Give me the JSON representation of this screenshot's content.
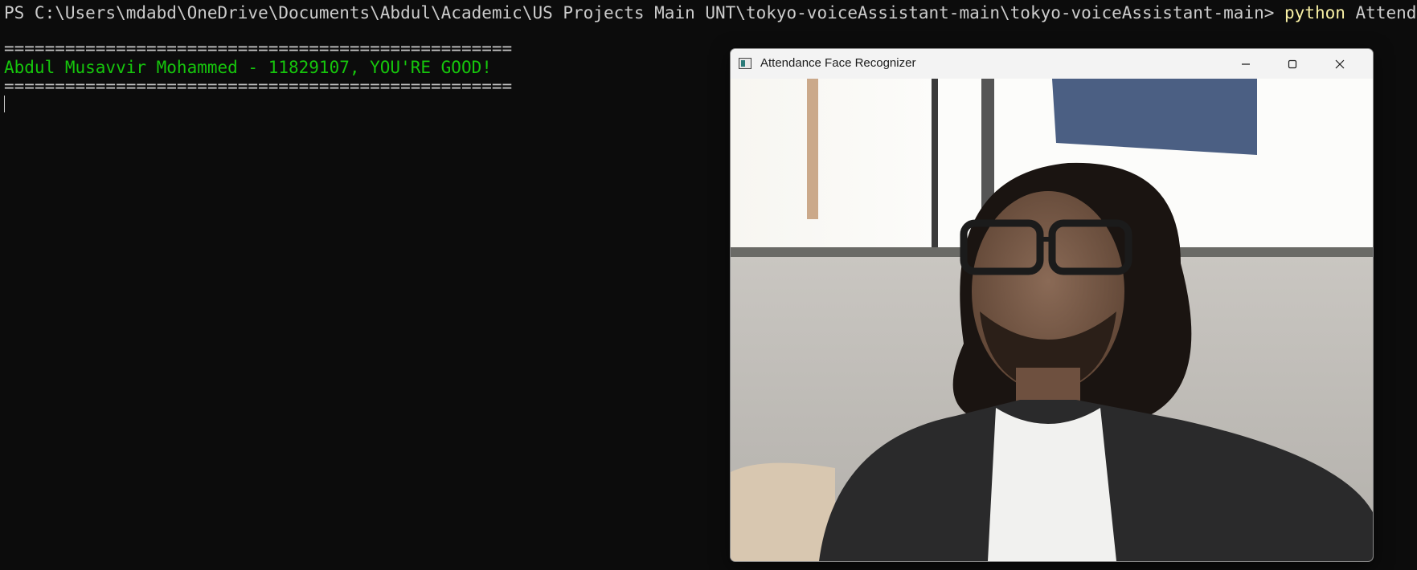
{
  "terminal": {
    "prompt": "PS C:\\Users\\mdabd\\OneDrive\\Documents\\Abdul\\Academic\\US Projects Main UNT\\tokyo-voiceAssistant-main\\tokyo-voiceAssistant-main> ",
    "command": "python",
    "argument": " Attendance.py",
    "rule": "==================================================",
    "result": "Abdul Musavvir Mohammed - 11829107, YOU'RE GOOD!"
  },
  "window": {
    "title": "Attendance Face Recognizer",
    "controls": {
      "minimize": "minimize-icon",
      "maximize": "maximize-icon",
      "close": "close-icon"
    }
  },
  "colors": {
    "terminal_bg": "#0c0c0c",
    "terminal_text": "#cccccc",
    "command": "#f9f1a5",
    "success": "#16c60c"
  }
}
